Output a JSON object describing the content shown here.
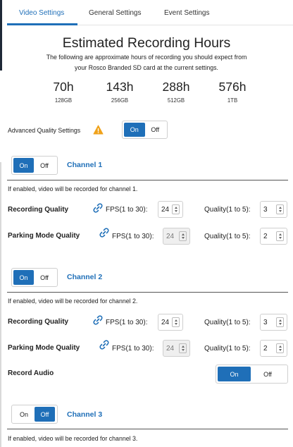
{
  "tabs": [
    {
      "label": "Video Settings",
      "active": true
    },
    {
      "label": "General Settings",
      "active": false
    },
    {
      "label": "Event Settings",
      "active": false
    }
  ],
  "header": {
    "title": "Estimated Recording Hours",
    "description_line1": "The following are approximate hours of recording you should expect from",
    "description_line2": "your Rosco Branded SD card at the current settings."
  },
  "estimates": [
    {
      "hours": "70h",
      "size": "128GB"
    },
    {
      "hours": "143h",
      "size": "256GB"
    },
    {
      "hours": "288h",
      "size": "512GB"
    },
    {
      "hours": "576h",
      "size": "1TB"
    }
  ],
  "advanced": {
    "label": "Advanced Quality Settings",
    "warning_icon": "warning-triangle-icon",
    "on_label": "On",
    "off_label": "Off",
    "state": "on"
  },
  "labels": {
    "on": "On",
    "off": "Off",
    "recording_quality": "Recording Quality",
    "parking_mode_quality": "Parking Mode Quality",
    "fps": "FPS(1 to 30):",
    "quality": "Quality(1 to 5):",
    "record_audio": "Record Audio"
  },
  "channels": [
    {
      "title": "Channel 1",
      "state": "on",
      "note": "If enabled, video will be recorded for channel 1.",
      "recording": {
        "fps": "24",
        "quality": "3"
      },
      "parking": {
        "fps": "24",
        "quality": "2"
      }
    },
    {
      "title": "Channel 2",
      "state": "on",
      "note": "If enabled, video will be recorded for channel 2.",
      "recording": {
        "fps": "24",
        "quality": "3"
      },
      "parking": {
        "fps": "24",
        "quality": "2"
      },
      "record_audio": "on"
    },
    {
      "title": "Channel 3",
      "state": "off",
      "note": "If enabled, video will be recorded for channel 3."
    }
  ],
  "colors": {
    "accent": "#1f6fb8",
    "warning": "#f0a21b"
  }
}
